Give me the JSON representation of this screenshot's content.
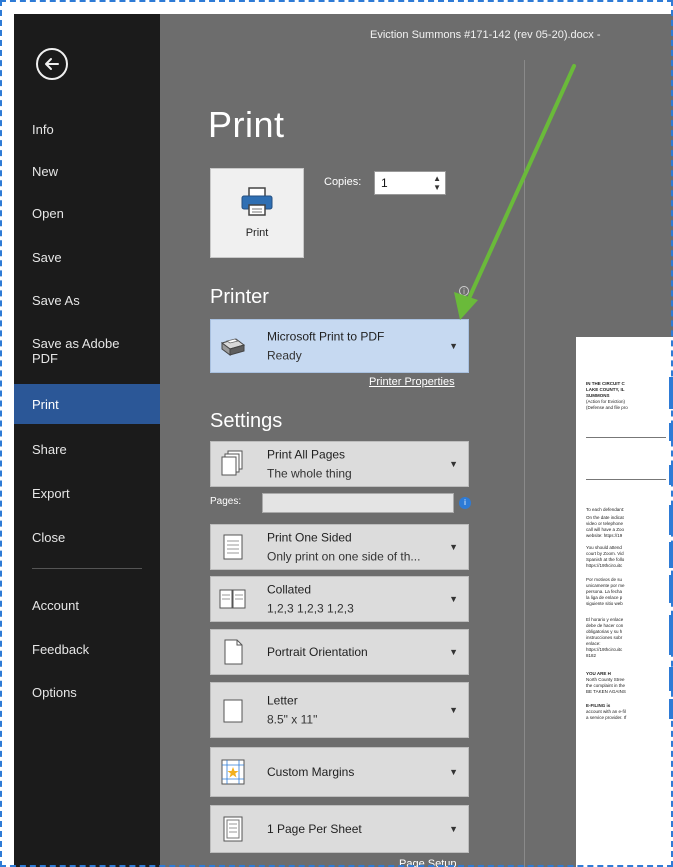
{
  "document": {
    "title": "Eviction Summons #171-142 (rev 05-20).docx  -"
  },
  "sidebar": {
    "items": [
      {
        "label": "Info"
      },
      {
        "label": "New"
      },
      {
        "label": "Open"
      },
      {
        "label": "Save"
      },
      {
        "label": "Save As"
      },
      {
        "label": "Save as Adobe PDF"
      },
      {
        "label": "Print"
      },
      {
        "label": "Share"
      },
      {
        "label": "Export"
      },
      {
        "label": "Close"
      },
      {
        "label": "Account"
      },
      {
        "label": "Feedback"
      },
      {
        "label": "Options"
      }
    ],
    "active": "Print"
  },
  "print": {
    "title": "Print",
    "button_label": "Print",
    "copies_label": "Copies:",
    "copies_value": "1"
  },
  "printer": {
    "section_title": "Printer",
    "name": "Microsoft Print to PDF",
    "status": "Ready",
    "properties_link": "Printer Properties"
  },
  "settings": {
    "section_title": "Settings",
    "pages_label": "Pages:",
    "pages_value": "",
    "options": [
      {
        "line1": "Print All Pages",
        "line2": "The whole thing",
        "icon": "pages-icon"
      },
      {
        "line1": "Print One Sided",
        "line2": "Only print on one side of th...",
        "icon": "one-sided-icon"
      },
      {
        "line1": "Collated",
        "line2": "1,2,3   1,2,3   1,2,3",
        "icon": "collated-icon"
      },
      {
        "line1": "Portrait Orientation",
        "line2": "",
        "icon": "portrait-icon"
      },
      {
        "line1": "Letter",
        "line2": "8.5\" x 11\"",
        "icon": "paper-size-icon"
      },
      {
        "line1": "Custom Margins",
        "line2": "",
        "icon": "margins-icon"
      },
      {
        "line1": "1 Page Per Sheet",
        "line2": "",
        "icon": "pages-per-sheet-icon"
      }
    ],
    "page_setup_link": "Page Setup"
  },
  "preview": {
    "lines": [
      "IN THE CIRCUIT C",
      "LAKE COUNTY, IL",
      "SUMMONS",
      "(Action for Eviction)",
      "(Defense and file pro",
      "To each defendant:",
      "On the date indicat",
      "video or telephone",
      "call will have a Zoo",
      "website: https://19",
      "You should attend",
      "court by Zoom. Vid",
      "Spanish at the follo",
      "https://19thcircuitc",
      "Por motivos de su",
      "unicamente por me",
      "persona. La fecha",
      "la liga de enlace p",
      "siguiente sitio web",
      "El horario y enlace",
      "debe de hacer con",
      "obligatorias y su h",
      "instrucciones sobr",
      "enlace:",
      "https://19thcircuitc",
      "8182",
      "YOU ARE H",
      "North County Stree",
      "the complaint in the",
      "BE TAKEN AGAINS",
      "E-FILING is",
      "account with an e-fil",
      "a service provider. If"
    ]
  },
  "colors": {
    "sidebar_bg": "#1b1b1b",
    "active_item": "#2b5797",
    "main_bg": "#6d6d6d",
    "selected_dropdown": "#c6d9f1",
    "annotation_arrow": "#6aba3a",
    "frame_border": "#2e7bd6"
  }
}
